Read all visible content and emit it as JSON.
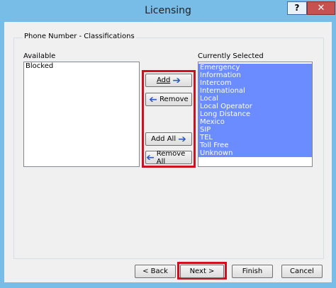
{
  "window": {
    "title": "Licensing",
    "help_label": "?",
    "close_label": "✕"
  },
  "group": {
    "title": "Phone Number - Classifications"
  },
  "available": {
    "label": "Available",
    "items": [
      "Blocked"
    ]
  },
  "selected": {
    "label": "Currently Selected",
    "items": [
      "Emergency",
      "Information",
      "Intercom",
      "International",
      "Local",
      "Local Operator",
      "Long Distance",
      "Mexico",
      "SIP",
      "TEL",
      "Toll Free",
      "Unknown"
    ]
  },
  "buttons": {
    "add": "Add",
    "remove": "Remove",
    "add_all": "Add All",
    "remove_all": "Remove All"
  },
  "footer": {
    "back": "< Back",
    "next": "Next >",
    "finish": "Finish",
    "cancel": "Cancel"
  },
  "colors": {
    "highlight": "#6a8cff",
    "annotation": "#d0101f"
  }
}
